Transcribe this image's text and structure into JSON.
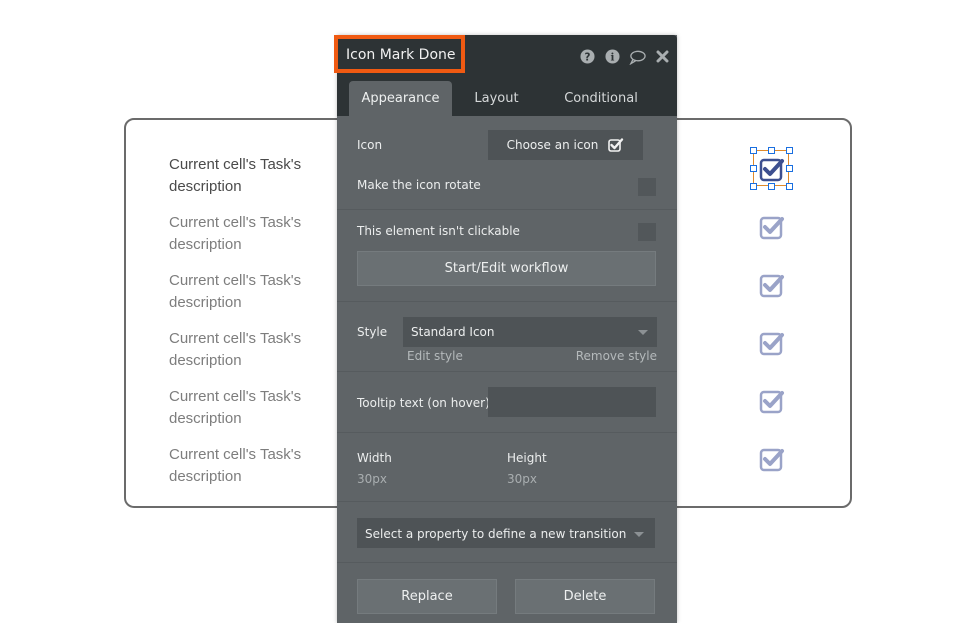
{
  "canvas": {
    "rows": [
      {
        "text": "Current cell's Task's description",
        "icon": "checkbox-checked-icon",
        "selected": true
      },
      {
        "text": "Current cell's Task's description",
        "icon": "checkbox-checked-icon",
        "selected": false
      },
      {
        "text": "Current cell's Task's description",
        "icon": "checkbox-checked-icon",
        "selected": false
      },
      {
        "text": "Current cell's Task's description",
        "icon": "checkbox-checked-icon",
        "selected": false
      },
      {
        "text": "Current cell's Task's description",
        "icon": "checkbox-checked-icon",
        "selected": false
      },
      {
        "text": "Current cell's Task's description",
        "icon": "checkbox-checked-icon",
        "selected": false
      }
    ],
    "icon_color_selected": "#3d4f8f",
    "icon_color": "#9aa3c8"
  },
  "panel": {
    "title": "Icon Mark Done",
    "header_icons": [
      "help-icon",
      "info-icon",
      "comment-icon",
      "close-icon"
    ],
    "tabs": [
      {
        "label": "Appearance",
        "active": true
      },
      {
        "label": "Layout",
        "active": false
      },
      {
        "label": "Conditional",
        "active": false
      }
    ],
    "icon_label": "Icon",
    "choose_icon_label": "Choose an icon",
    "rotate_label": "Make the icon rotate",
    "rotate_checked": false,
    "not_clickable_label": "This element isn't clickable",
    "not_clickable_checked": false,
    "workflow_button": "Start/Edit workflow",
    "style_label": "Style",
    "style_value": "Standard Icon",
    "edit_style": "Edit style",
    "remove_style": "Remove style",
    "tooltip_label": "Tooltip text (on hover)",
    "tooltip_value": "",
    "width_label": "Width",
    "width_value": "30px",
    "height_label": "Height",
    "height_value": "30px",
    "transition_placeholder": "Select a property to define a new transition",
    "replace_button": "Replace",
    "delete_button": "Delete",
    "accent_color": "#f05a12"
  }
}
